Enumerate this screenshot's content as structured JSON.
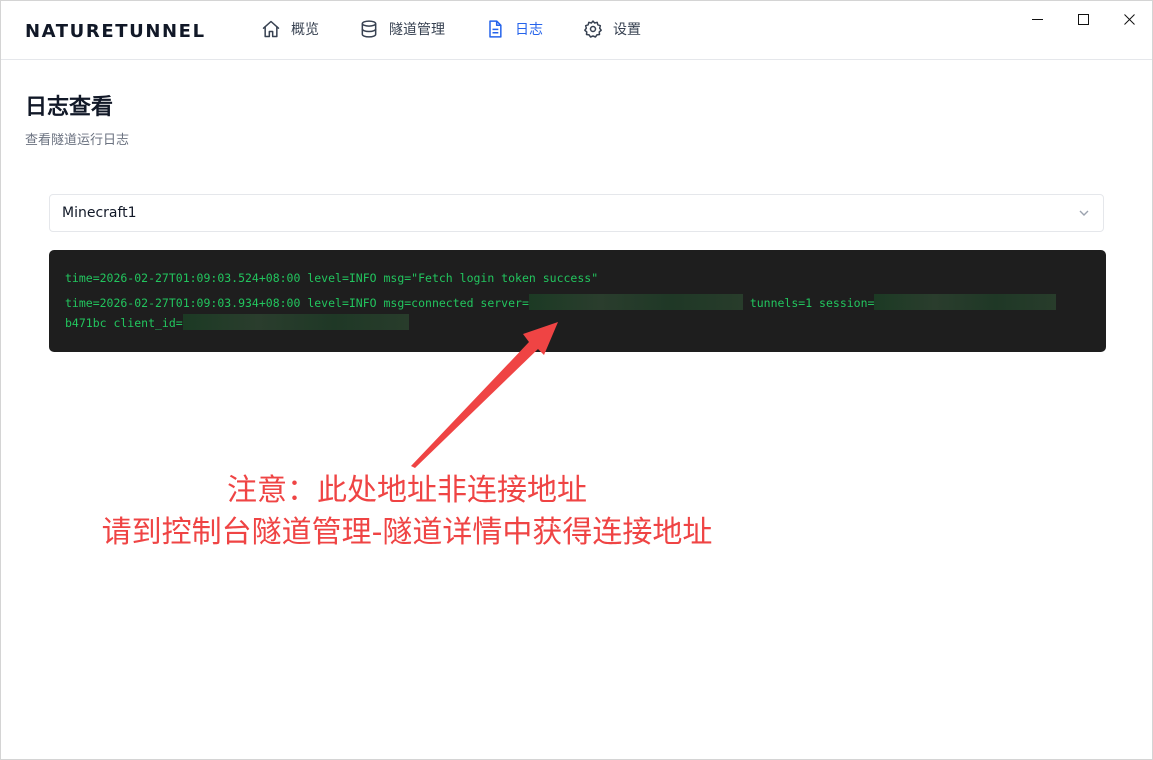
{
  "app": {
    "brand": "NATURETUNNEL"
  },
  "nav": [
    {
      "label": "概览",
      "icon": "home-icon",
      "active": false
    },
    {
      "label": "隧道管理",
      "icon": "database-icon",
      "active": false
    },
    {
      "label": "日志",
      "icon": "file-text-icon",
      "active": true
    },
    {
      "label": "设置",
      "icon": "gear-icon",
      "active": false
    }
  ],
  "window_controls": [
    "minimize-icon",
    "maximize-icon",
    "close-icon"
  ],
  "page": {
    "title": "日志查看",
    "subtitle": "查看隧道运行日志"
  },
  "tunnel_select": {
    "value": "Minecraft1",
    "icon": "chevron-down-icon"
  },
  "log": {
    "line1": "time=2026-02-27T01:09:03.524+08:00 level=INFO msg=\"Fetch login token success\"",
    "line2_a": "time=2026-02-27T01:09:03.934+08:00 level=INFO msg=connected server=",
    "line2_b": " tunnels=1 session=",
    "line3_a": "b471bc client_id=",
    "line3_b": ""
  },
  "annotation": {
    "line1": "注意：此处地址非连接地址",
    "line2": "请到控制台隧道管理-隧道详情中获得连接地址",
    "color": "#ef4444"
  },
  "colors": {
    "accent": "#2563eb",
    "log_bg": "#1e1e1e",
    "log_text": "#22c55e"
  }
}
